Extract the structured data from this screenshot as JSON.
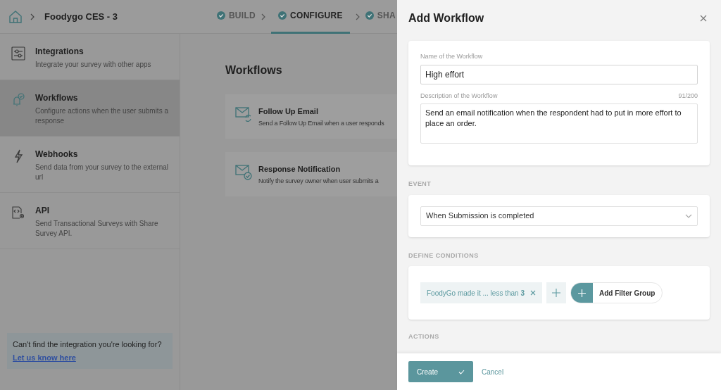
{
  "header": {
    "breadcrumb": "Foodygo CES - 3",
    "steps": [
      {
        "label": "BUILD",
        "selected": false
      },
      {
        "label": "CONFIGURE",
        "selected": true
      },
      {
        "label": "SHA",
        "selected": false
      }
    ]
  },
  "sidebar": {
    "items": [
      {
        "kind": "integrations",
        "title": "Integrations",
        "description": "Integrate your survey with other apps",
        "selected": false
      },
      {
        "kind": "workflows",
        "title": "Workflows",
        "description": "Configure actions when the user submits a response",
        "selected": true
      },
      {
        "kind": "webhooks",
        "title": "Webhooks",
        "description": "Send data from your survey to the external url",
        "selected": false
      },
      {
        "kind": "api",
        "title": "API",
        "description": "Send Transactional Surveys with Share Survey API.",
        "selected": false
      }
    ],
    "help": {
      "text": "Can't find the integration you're looking for?",
      "link": "Let us know here"
    }
  },
  "main": {
    "title": "Workflows",
    "cards": [
      {
        "kind": "followup",
        "title": "Follow Up Email",
        "description": "Send a Follow Up Email when a user responds"
      },
      {
        "kind": "notification",
        "title": "Response Notification",
        "description": "Notify the survey owner when user submits a"
      }
    ]
  },
  "drawer": {
    "title": "Add Workflow",
    "name_label": "Name of the Workflow",
    "name_value": "High effort",
    "description_label": "Description of the Workflow",
    "description_count": "91/200",
    "description_value": "Send an email notification when the respondent had to put in more effort to place an order.",
    "event_heading": "EVENT",
    "event_value": "When Submission is completed",
    "conditions_heading": "DEFINE CONDITIONS",
    "conditions": [
      {
        "text": "FoodyGo made it ... less than **3**"
      }
    ],
    "add_filter_group": "Add Filter Group",
    "actions_heading": "ACTIONS",
    "create": "Create",
    "cancel": "Cancel"
  }
}
